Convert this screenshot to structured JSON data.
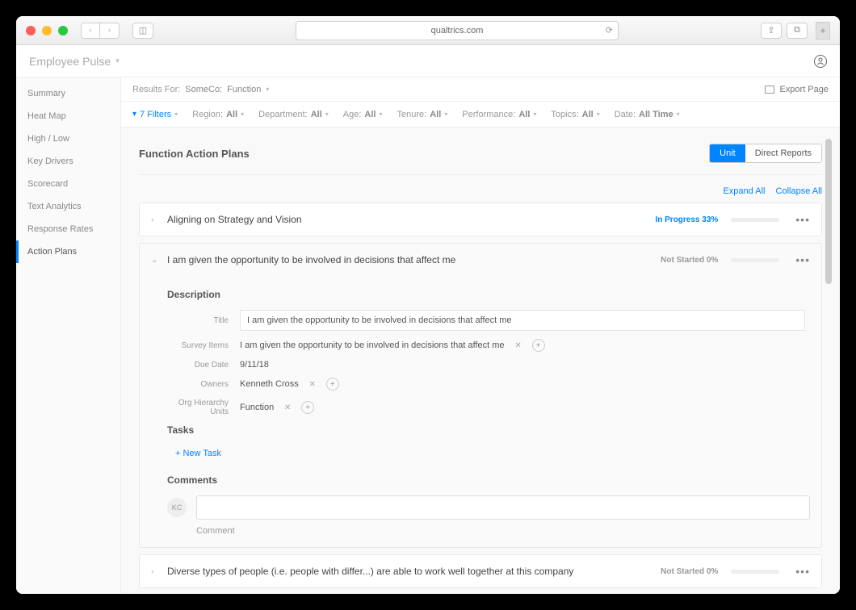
{
  "browser": {
    "url": "qualtrics.com"
  },
  "app": {
    "title": "Employee Pulse"
  },
  "sidebar": {
    "items": [
      {
        "label": "Summary"
      },
      {
        "label": "Heat Map"
      },
      {
        "label": "High / Low"
      },
      {
        "label": "Key Drivers"
      },
      {
        "label": "Scorecard"
      },
      {
        "label": "Text Analytics"
      },
      {
        "label": "Response Rates"
      },
      {
        "label": "Action Plans"
      }
    ]
  },
  "subheader": {
    "results_for_label": "Results For:",
    "org": "SomeCo:",
    "scope": "Function",
    "export": "Export Page"
  },
  "filters": {
    "count_label": "7 Filters",
    "items": [
      {
        "label": "Region:",
        "value": "All"
      },
      {
        "label": "Department:",
        "value": "All"
      },
      {
        "label": "Age:",
        "value": "All"
      },
      {
        "label": "Tenure:",
        "value": "All"
      },
      {
        "label": "Performance:",
        "value": "All"
      },
      {
        "label": "Topics:",
        "value": "All"
      },
      {
        "label": "Date:",
        "value": "All Time"
      }
    ]
  },
  "panel": {
    "title": "Function Action Plans",
    "segments": {
      "unit": "Unit",
      "direct": "Direct Reports"
    },
    "expand": "Expand All",
    "collapse": "Collapse All"
  },
  "plans": [
    {
      "title": "Aligning on Strategy and Vision",
      "status": "In Progress 33%",
      "progress": 33,
      "status_color": "blue"
    },
    {
      "title": "I am given the opportunity to be involved in decisions that affect me",
      "status": "Not Started 0%",
      "progress": 0,
      "status_color": "grey",
      "expanded": true
    },
    {
      "title": "Diverse types of people (i.e. people with differ...) are able to work well together at this company",
      "status": "Not Started 0%",
      "progress": 0,
      "status_color": "grey"
    }
  ],
  "detail": {
    "description_label": "Description",
    "fields": {
      "title": {
        "label": "Title",
        "value": "I am given the opportunity to be involved in decisions that affect me"
      },
      "survey_items": {
        "label": "Survey Items",
        "value": "I am given the opportunity to be involved in decisions that affect me"
      },
      "due_date": {
        "label": "Due Date",
        "value": "9/11/18"
      },
      "owners": {
        "label": "Owners",
        "value": "Kenneth Cross"
      },
      "org_units": {
        "label": "Org Hierarchy Units",
        "value": "Function"
      }
    },
    "tasks_label": "Tasks",
    "new_task": "+ New Task",
    "comments_label": "Comments",
    "avatar_initials": "KC",
    "comment_btn": "Comment"
  }
}
